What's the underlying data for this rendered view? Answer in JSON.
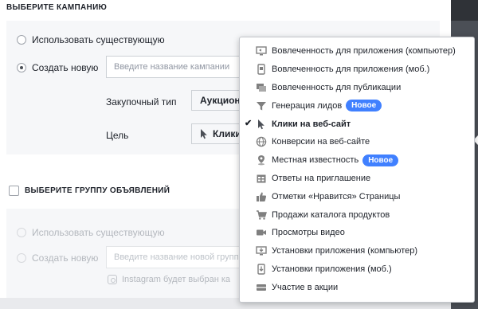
{
  "campaign": {
    "title": "ВЫБЕРИТЕ КАМПАНИЮ",
    "use_existing_label": "Использовать существующую",
    "create_new_label": "Создать новую",
    "name_placeholder": "Введите название кампании",
    "buying_type_label": "Закупочный тип",
    "buying_type_value": "Аукцион",
    "objective_label": "Цель",
    "objective_value": "Клики"
  },
  "adset": {
    "title": "ВЫБЕРИТЕ ГРУППУ ОБЪЯВЛЕНИЙ",
    "use_existing_label": "Использовать существующую",
    "create_new_label": "Создать новую",
    "name_placeholder": "Введите название новой групп",
    "instagram_note": "Instagram будет выбран ка"
  },
  "menu": {
    "items": [
      {
        "label": "Вовлеченность для приложения (компьютер)",
        "icon": "desktop-app-icon",
        "badge": "",
        "selected": false
      },
      {
        "label": "Вовлеченность для приложения (моб.)",
        "icon": "mobile-app-icon",
        "badge": "",
        "selected": false
      },
      {
        "label": "Вовлеченность для публикации",
        "icon": "post-engagement-icon",
        "badge": "",
        "selected": false
      },
      {
        "label": "Генерация лидов",
        "icon": "funnel-icon",
        "badge": "Новое",
        "selected": false
      },
      {
        "label": "Клики на веб-сайт",
        "icon": "cursor-icon",
        "badge": "",
        "selected": true
      },
      {
        "label": "Конверсии на веб-сайте",
        "icon": "globe-icon",
        "badge": "",
        "selected": false
      },
      {
        "label": "Местная известность",
        "icon": "map-pin-icon",
        "badge": "Новое",
        "selected": false
      },
      {
        "label": "Ответы на приглашение",
        "icon": "event-icon",
        "badge": "",
        "selected": false
      },
      {
        "label": "Отметки «Нравится» Страницы",
        "icon": "thumbs-up-icon",
        "badge": "",
        "selected": false
      },
      {
        "label": "Продажи каталога продуктов",
        "icon": "cart-icon",
        "badge": "",
        "selected": false
      },
      {
        "label": "Просмотры видео",
        "icon": "video-camera-icon",
        "badge": "",
        "selected": false
      },
      {
        "label": "Установки приложения (компьютер)",
        "icon": "desktop-install-icon",
        "badge": "",
        "selected": false
      },
      {
        "label": "Установки приложения (моб.)",
        "icon": "mobile-install-icon",
        "badge": "",
        "selected": false
      },
      {
        "label": "Участие в акции",
        "icon": "offer-icon",
        "badge": "",
        "selected": false
      }
    ]
  },
  "colors": {
    "accent": "#4080ff",
    "icon": "#7f7f7f",
    "strip": "#4b4f56"
  }
}
